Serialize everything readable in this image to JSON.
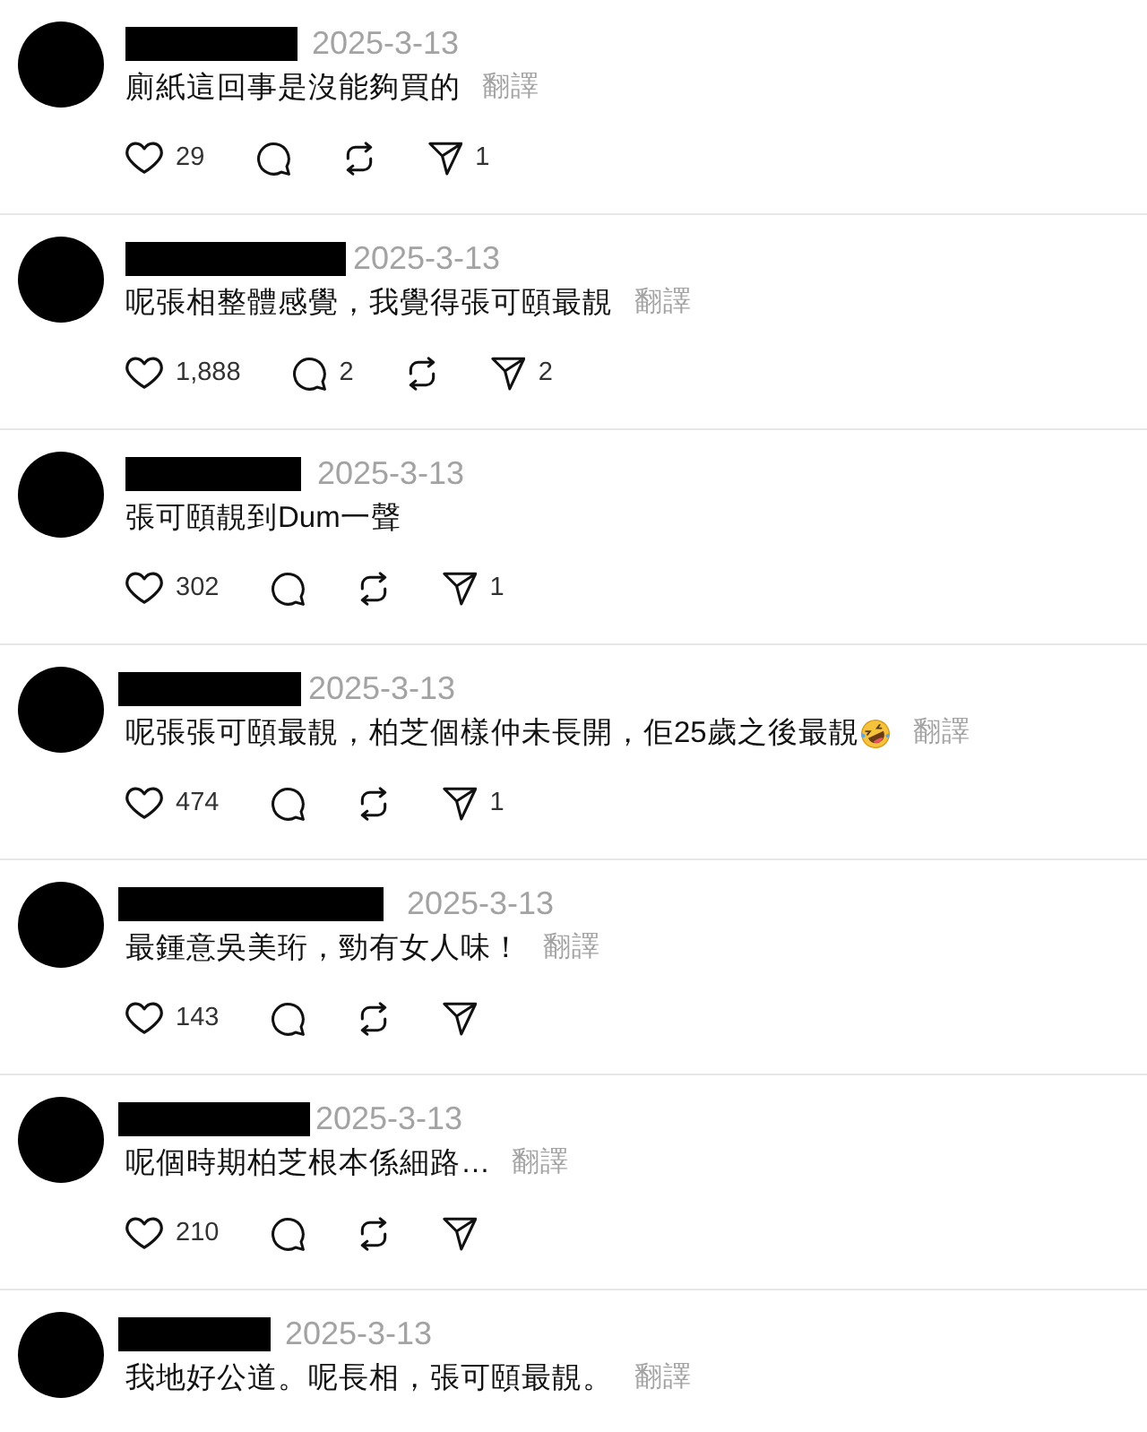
{
  "comments": [
    {
      "date": "2025-3-13",
      "text": "廁紙這回事是沒能夠買的",
      "emoji": false,
      "translate": "翻譯",
      "actions": {
        "like": "29",
        "share": "1"
      }
    },
    {
      "date": "2025-3-13",
      "text": "呢張相整體感覺，我覺得張可頤最靚",
      "emoji": false,
      "translate": "翻譯",
      "actions": {
        "like": "1,888",
        "reply": "2",
        "share": "2"
      }
    },
    {
      "date": "2025-3-13",
      "text": "張可頤靚到Dum一聲",
      "emoji": false,
      "actions": {
        "like": "302",
        "share": "1"
      }
    },
    {
      "date": "2025-3-13",
      "text": "呢張張可頤最靚，柏芝個樣仲未長開，佢25歲之後最靚",
      "emoji": true,
      "translate": "翻譯",
      "actions": {
        "like": "474",
        "share": "1"
      }
    },
    {
      "date": "2025-3-13",
      "text": "最鍾意吳美珩，勁有女人味！",
      "emoji": false,
      "translate": "翻譯",
      "actions": {
        "like": "143"
      }
    },
    {
      "date": "2025-3-13",
      "text": "呢個時期柏芝根本係細路…",
      "emoji": false,
      "translate": "翻譯",
      "actions": {
        "like": "210"
      }
    },
    {
      "date": "2025-3-13",
      "text": "我地好公道。呢長相，張可頤最靚。",
      "emoji": false,
      "translate": "翻譯"
    }
  ]
}
